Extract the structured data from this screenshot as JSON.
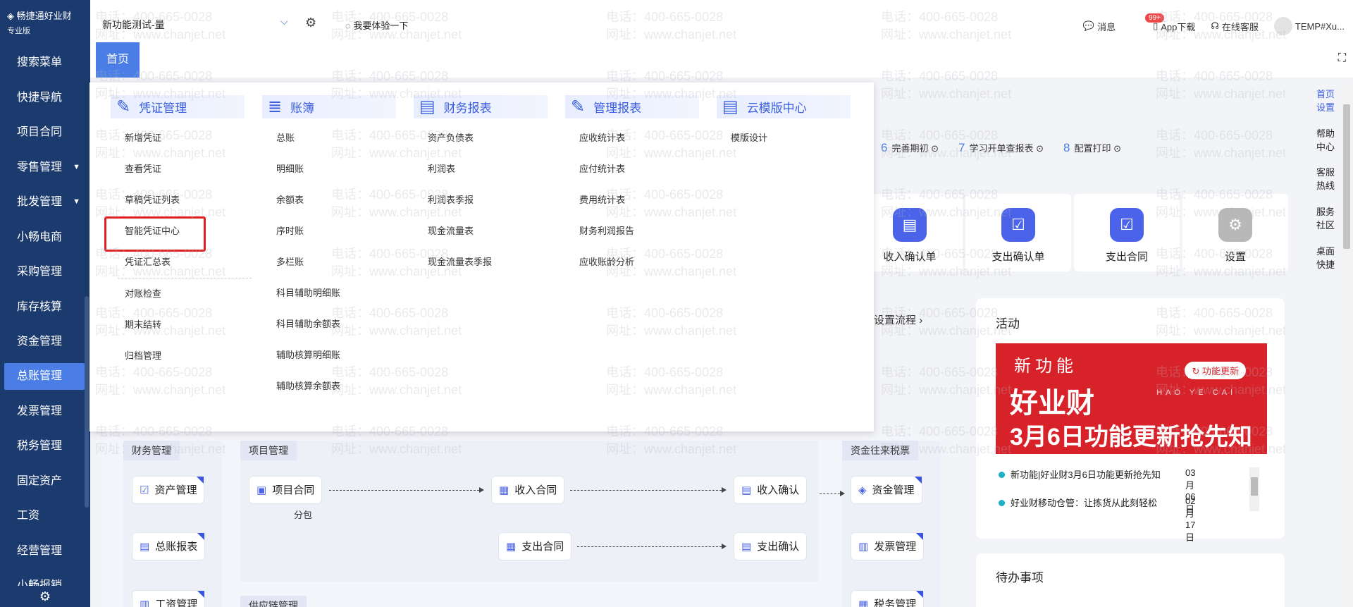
{
  "app": {
    "logo_text": "畅捷通好业财",
    "edition": "专业版"
  },
  "sidebar": {
    "items": [
      {
        "label": "搜索菜单"
      },
      {
        "label": "快捷导航"
      },
      {
        "label": "项目合同"
      },
      {
        "label": "零售管理",
        "caret": "▼"
      },
      {
        "label": "批发管理",
        "caret": "▼"
      },
      {
        "label": "小畅电商"
      },
      {
        "label": "采购管理"
      },
      {
        "label": "库存核算"
      },
      {
        "label": "资金管理"
      },
      {
        "label": "总账管理",
        "active": true
      },
      {
        "label": "发票管理"
      },
      {
        "label": "税务管理"
      },
      {
        "label": "固定资产"
      },
      {
        "label": "工资"
      },
      {
        "label": "经营管理"
      },
      {
        "label": "小畅报销"
      }
    ]
  },
  "topbar": {
    "company": "新功能测试-量",
    "try_label": "我要体验一下",
    "messages": "消息",
    "badge": "99+",
    "app_download": "App下载",
    "online_service": "在线客服",
    "user": "TEMP#Xu..."
  },
  "tabs": {
    "home": "首页"
  },
  "menu": {
    "columns": [
      {
        "title": "凭证管理",
        "items": [
          "新增凭证",
          "查看凭证",
          "草稿凭证列表",
          "智能凭证中心",
          "凭证汇总表",
          "对账检查",
          "期末结转",
          "归档管理"
        ]
      },
      {
        "title": "账簿",
        "items": [
          "总账",
          "明细账",
          "余额表",
          "序时账",
          "多栏账",
          "科目辅助明细账",
          "科目辅助余额表",
          "辅助核算明细账",
          "辅助核算余额表"
        ]
      },
      {
        "title": "财务报表",
        "items": [
          "资产负债表",
          "利润表",
          "利润表季报",
          "现金流量表",
          "现金流量表季报"
        ]
      },
      {
        "title": "管理报表",
        "items": [
          "应收统计表",
          "应付统计表",
          "费用统计表",
          "财务利润报告",
          "应收账龄分析"
        ]
      },
      {
        "title": "云模版中心",
        "items": [
          "模版设计"
        ]
      }
    ]
  },
  "steps": [
    {
      "num": "6",
      "label": "完善期初"
    },
    {
      "num": "7",
      "label": "学习开单查报表"
    },
    {
      "num": "8",
      "label": "配置打印"
    }
  ],
  "shortcuts": [
    {
      "label": "收入确认单"
    },
    {
      "label": "支出确认单"
    },
    {
      "label": "支出合同"
    },
    {
      "label": "设置"
    }
  ],
  "setup_link": "设置流程",
  "activity": {
    "title": "活动",
    "banner": {
      "line1": "新功能",
      "line2": "好业财",
      "line3_a": "3月6日功能更新",
      "line3_b": "抢先知",
      "pill": "功能更新",
      "wm": "HAO YE CAI"
    },
    "news": [
      {
        "text": "新功能|好业财3月6日功能更新抢先知",
        "date": "03月06日"
      },
      {
        "text": "好业财移动仓管：让拣货从此刻轻松",
        "date": "02月17日"
      }
    ]
  },
  "todo": {
    "title": "待办事项"
  },
  "flow": {
    "group_finance": "财务管理",
    "group_project": "项目管理",
    "group_funds": "资金往来税票",
    "group_supply": "供应链管理",
    "nodes": {
      "asset": "资产管理",
      "ledger": "总账报表",
      "salary": "工资管理",
      "project_contract": "项目合同",
      "income_contract": "收入合同",
      "expense_contract": "支出合同",
      "income_confirm": "收入确认",
      "expense_confirm": "支出确认",
      "funds": "资金管理",
      "invoice": "发票管理",
      "tax": "税务管理",
      "subcontract": "分包"
    }
  },
  "rightrail": [
    {
      "l1": "首页",
      "l2": "设置",
      "blue": true
    },
    {
      "l1": "帮助",
      "l2": "中心"
    },
    {
      "l1": "客服",
      "l2": "热线"
    },
    {
      "l1": "服务",
      "l2": "社区"
    },
    {
      "l1": "桌面",
      "l2": "快捷"
    }
  ],
  "watermark": {
    "phone": "电话：400-665-0028",
    "site": "网址：www.chanjet.net"
  }
}
